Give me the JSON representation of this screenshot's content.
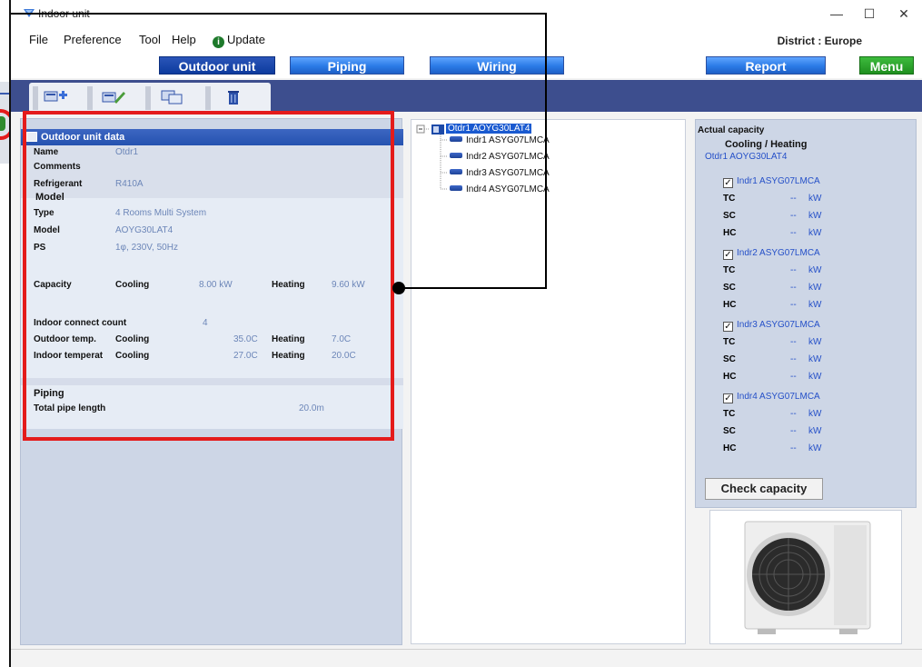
{
  "window": {
    "title": "Indoor unit",
    "controls": {
      "minimize": "—",
      "maximize": "☐",
      "close": "✕"
    }
  },
  "menu": {
    "items": [
      "File",
      "Preference",
      "Tool",
      "Help"
    ],
    "update": "Update",
    "district": "District : Europe"
  },
  "nav": {
    "outdoor_unit": "Outdoor unit",
    "piping": "Piping",
    "wiring": "Wiring",
    "report": "Report",
    "menu": "Menu"
  },
  "outdoor_panel": {
    "header": "Outdoor unit data",
    "name_label": "Name",
    "name_value": "Otdr1",
    "comments_label": "Comments",
    "refrigerant_label": "Refrigerant",
    "refrigerant_value": "R410A",
    "model_section": "Model",
    "type_label": "Type",
    "type_value": "4 Rooms Multi System",
    "model_label": "Model",
    "model_value": "AOYG30LAT4",
    "ps_label": "PS",
    "ps_value": "1φ, 230V, 50Hz",
    "capacity_label": "Capacity",
    "cooling": "Cooling",
    "heating": "Heating",
    "cap_cooling_value": "8.00 kW",
    "cap_heating_value": "9.60 kW",
    "indoor_count_label": "Indoor connect count",
    "indoor_count_value": "4",
    "outdoor_temp_label": "Outdoor temp.",
    "outdoor_cooling_value": "35.0C",
    "outdoor_heating_value": "7.0C",
    "indoor_temp_label": "Indoor temperat",
    "indoor_cooling_value": "27.0C",
    "indoor_heating_value": "20.0C",
    "piping_section": "Piping",
    "pipe_length_label": "Total pipe length",
    "pipe_length_value": "20.0m"
  },
  "tree": {
    "root": "Otdr1  AOYG30LAT4",
    "children": [
      "Indr1  ASYG07LMCA",
      "Indr2  ASYG07LMCA",
      "Indr3  ASYG07LMCA",
      "Indr4  ASYG07LMCA"
    ]
  },
  "capacity_panel": {
    "title": "Actual capacity",
    "mode": "Cooling / Heating",
    "outdoor": "Otdr1  AOYG30LAT4",
    "units": [
      {
        "name": "Indr1  ASYG07LMCA",
        "checked": "✓"
      },
      {
        "name": "Indr2  ASYG07LMCA",
        "checked": "✓"
      },
      {
        "name": "Indr3  ASYG07LMCA",
        "checked": "✓"
      },
      {
        "name": "Indr4  ASYG07LMCA",
        "checked": "✓"
      }
    ],
    "tc": "TC",
    "sc": "SC",
    "hc": "HC",
    "dash": "--",
    "unit": "kW",
    "check_button": "Check capacity"
  },
  "colors": {
    "accent_blue": "#2a7ae6",
    "dark_blue": "#0d3b9e",
    "menu_green": "#1f8f1f",
    "annotation_red": "#e41b1b",
    "value_text": "#6c86b8",
    "link_blue": "#2550c8"
  }
}
